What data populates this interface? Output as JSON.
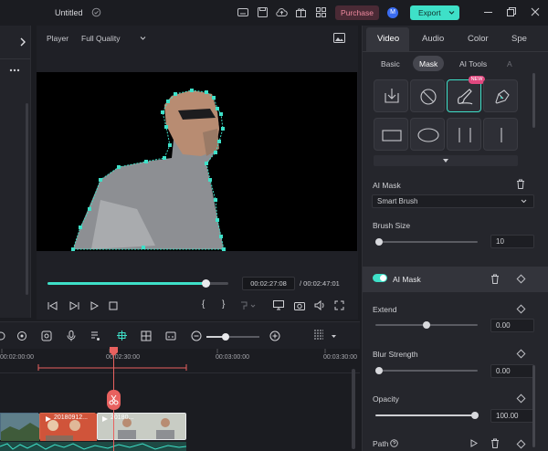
{
  "titlebar": {
    "title": "Untitled",
    "purchase_label": "Purchase",
    "avatar_letter": "M",
    "export_label": "Export"
  },
  "player": {
    "label": "Player",
    "quality": "Full Quality",
    "current_time": "00:02:27:08",
    "total_time": "/ 00:02:47:01",
    "progress": 0.88
  },
  "right_panel": {
    "tabs": [
      "Video",
      "Audio",
      "Color",
      "Spe"
    ],
    "active_tab": "Video",
    "subtabs": [
      "Basic",
      "Mask",
      "AI Tools",
      "A"
    ],
    "active_subtab": "Mask",
    "new_badge": "NEW",
    "ai_mask_header": "AI Mask",
    "ai_mask_dropdown": "Smart Brush",
    "brush_size_label": "Brush Size",
    "brush_size_value": "10",
    "ai_mask_toggle_label": "AI Mask",
    "extend_label": "Extend",
    "extend_value": "0.00",
    "blur_label": "Blur Strength",
    "blur_value": "0.00",
    "opacity_label": "Opacity",
    "opacity_value": "100.00",
    "path_label": "Path"
  },
  "timeline": {
    "ticks": [
      "00:02:00:00",
      "00:02:30:00",
      "00:03:00:00",
      "00:03:30:00"
    ],
    "clip1_label": "20180912...",
    "clip2_label": "20180..."
  },
  "colors": {
    "accent": "#3ee0c8",
    "purchase": "#e0607a",
    "export": "#3ee0c8",
    "playhead": "#e8615f"
  }
}
